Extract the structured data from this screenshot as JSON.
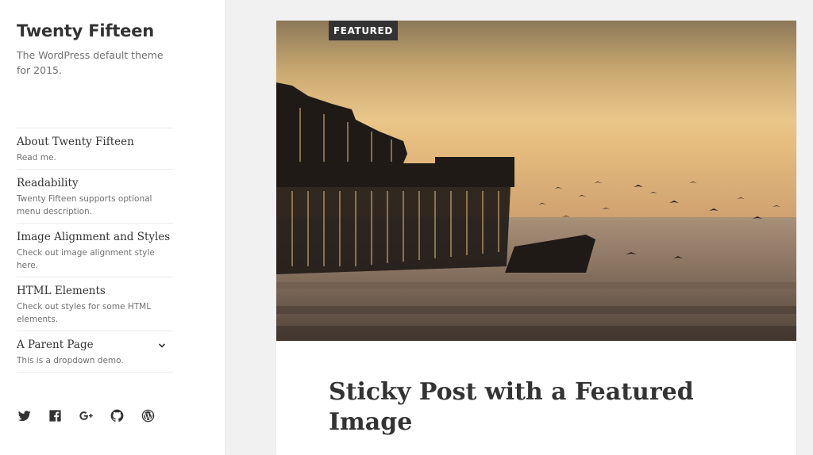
{
  "site": {
    "title": "Twenty Fifteen",
    "description": "The WordPress default theme for 2015."
  },
  "menu": {
    "items": [
      {
        "label": "About Twenty Fifteen",
        "description": "Read me."
      },
      {
        "label": "Readability",
        "description": "Twenty Fifteen supports optional menu description."
      },
      {
        "label": "Image Alignment and Styles",
        "description": "Check out image alignment style here."
      },
      {
        "label": "HTML Elements",
        "description": "Check out styles for some HTML elements."
      },
      {
        "label": "A Parent Page",
        "description": "This is a dropdown demo.",
        "has_dropdown": true
      }
    ]
  },
  "social": {
    "icons": [
      "twitter-icon",
      "facebook-icon",
      "google-plus-icon",
      "github-icon",
      "wordpress-icon"
    ]
  },
  "post": {
    "badge": "FEATURED",
    "title": "Sticky Post with a Featured Image"
  },
  "colors": {
    "background": "#f1f1f1",
    "sidebar": "#ffffff",
    "text": "#333333",
    "muted": "#707070",
    "badge": "#333333"
  }
}
